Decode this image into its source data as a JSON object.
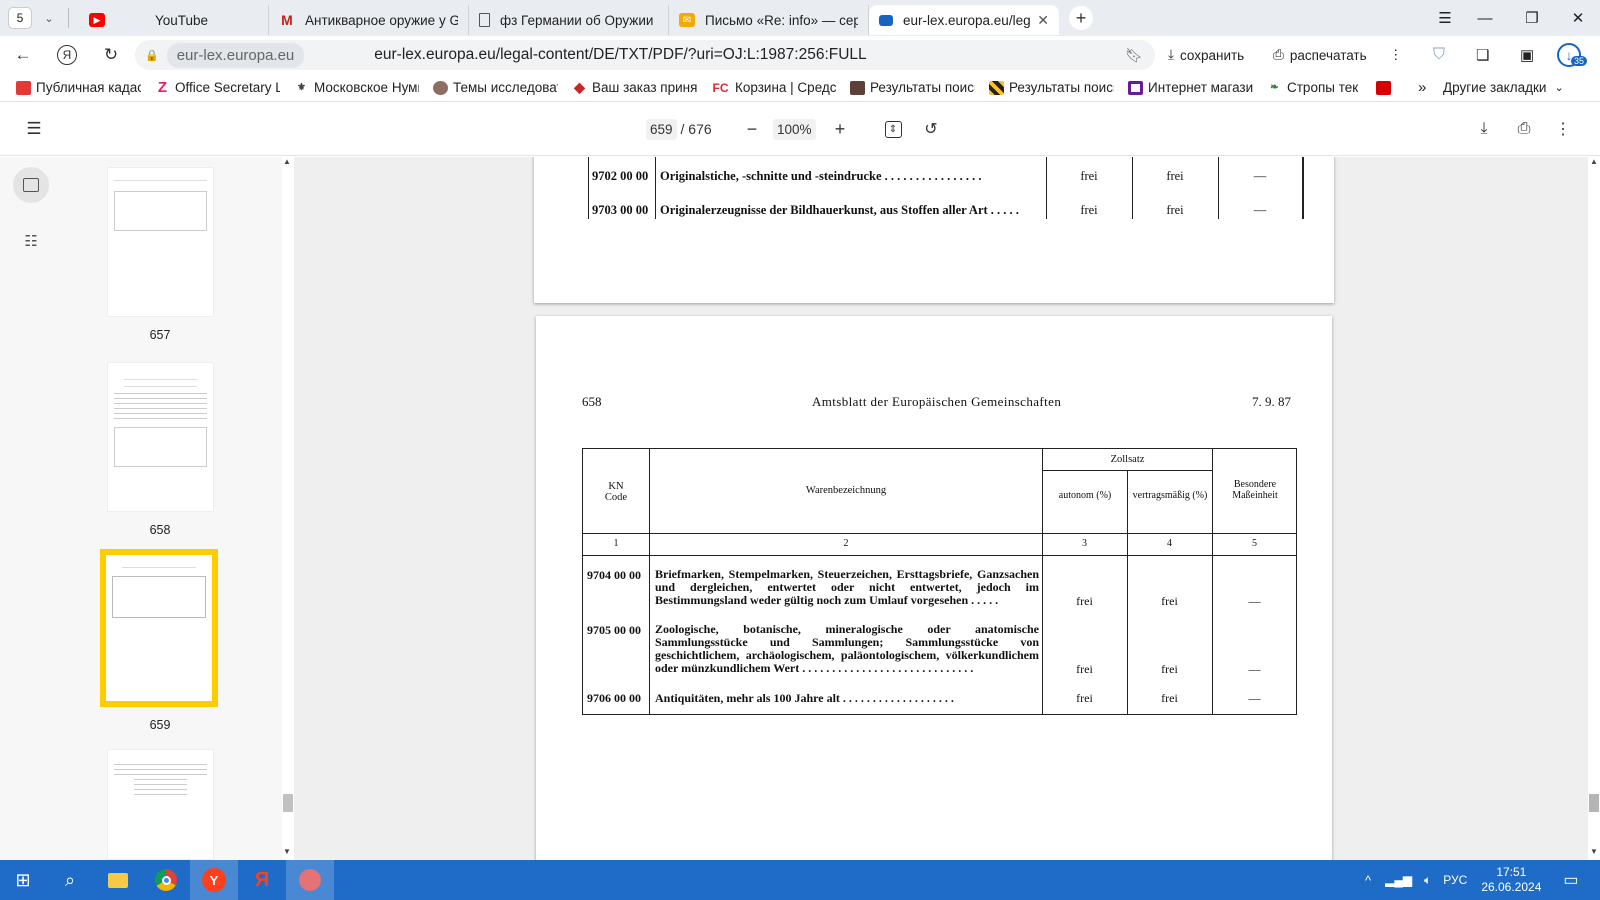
{
  "browser": {
    "tab_count": "5",
    "tabs": [
      {
        "title": "YouTube",
        "icon": "youtube-icon",
        "color": "#ff0000"
      },
      {
        "title": "Антикварное оружие у G",
        "icon": "gmail-m-icon",
        "color": "#c5221f"
      },
      {
        "title": "фз Германии об Оружии",
        "icon": "document-icon",
        "color": "#555555"
      },
      {
        "title": "Письмо «Re: info» — серге",
        "icon": "mail-icon",
        "color": "#f2a900"
      },
      {
        "title": "eur-lex.europa.eu/legal-",
        "icon": "monitor-icon",
        "color": "#1565c0"
      }
    ],
    "address": {
      "host": "eur-lex.europa.eu",
      "url": "eur-lex.europa.eu/legal-content/DE/TXT/PDF/?uri=OJ:L:1987:256:FULL"
    },
    "actions": {
      "save": "сохранить",
      "print": "распечатать"
    },
    "badge_count": "35",
    "bookmarks": [
      {
        "label": "Публичная кадас",
        "color": "#e53935"
      },
      {
        "label": "Office Secretary L",
        "color": "#e91e63"
      },
      {
        "label": "Московское Нуми",
        "color": "#444444"
      },
      {
        "label": "Темы исследоват",
        "color": "#8d6e63"
      },
      {
        "label": "Ваш заказ принят",
        "color": "#c62828"
      },
      {
        "label": "Корзина | Средст",
        "color": "#d32f2f"
      },
      {
        "label": "Результаты поиск",
        "color": "#5d4037"
      },
      {
        "label": "Результаты поиск",
        "color": "#fbc02d"
      },
      {
        "label": "Интернет магазин",
        "color": "#6a1b9a"
      },
      {
        "label": "Стропы тек",
        "color": "#2e7d32"
      },
      {
        "label": "",
        "color": "#d50000"
      }
    ],
    "bookmark_fc": "FC",
    "bookmarks_more": "»",
    "other_bookmarks": "Другие закладки"
  },
  "pdf": {
    "current_page": "659",
    "total_pages": "/ 676",
    "zoom": "100%",
    "thumbnails": [
      {
        "label": "657"
      },
      {
        "label": "658"
      },
      {
        "label": "659"
      }
    ]
  },
  "page_top": {
    "rows": [
      {
        "code": "9702 00 00",
        "desc": "Originalstiche, -schnitte und -steindrucke . . . . . . . . . . . . . . . .",
        "autonom": "frei",
        "vertrag": "frei",
        "special": "—"
      },
      {
        "code": "9703 00 00",
        "desc": "Originalerzeugnisse der Bildhauerkunst, aus Stoffen aller Art . . . . .",
        "autonom": "frei",
        "vertrag": "frei",
        "special": "—"
      }
    ]
  },
  "page_main": {
    "page_number": "658",
    "journal": "Amtsblatt der Europäischen Gemeinschaften",
    "date": "7. 9. 87",
    "headers": {
      "code": "KN Code",
      "desc": "Warenbezeichnung",
      "zollsatz": "Zollsatz",
      "autonom": "autonom (%)",
      "vertrag": "vertragsmäßig (%)",
      "special": "Besondere Maßeinheit"
    },
    "col_numbers": [
      "1",
      "2",
      "3",
      "4",
      "5"
    ],
    "rows": [
      {
        "code": "9704 00 00",
        "desc": "Briefmarken, Stempelmarken, Steuerzeichen, Ersttagsbriefe, Ganzsachen und dergleichen, entwertet oder nicht entwertet, jedoch im Bestimmungsland weder gültig noch zum Umlauf vorgesehen . . . . .",
        "autonom": "frei",
        "vertrag": "frei",
        "special": "—"
      },
      {
        "code": "9705 00 00",
        "desc": "Zoologische, botanische, mineralogische oder anatomische Sammlungsstücke und Sammlungen; Sammlungsstücke von geschichtlichem, archäologischem, paläontologischem, völkerkundlichem oder münzkundlichem Wert . . . . . . . . . . . . . . . . . . . . . . . . . . . . .",
        "autonom": "frei",
        "vertrag": "frei",
        "special": "—"
      },
      {
        "code": "9706 00 00",
        "desc": "Antiquitäten, mehr als 100 Jahre alt . . . . . . . . . . . . . . . . . . .",
        "autonom": "frei",
        "vertrag": "frei",
        "special": "—"
      }
    ]
  },
  "taskbar": {
    "lang": "РУС",
    "time": "17:51",
    "date": "26.06.2024"
  }
}
